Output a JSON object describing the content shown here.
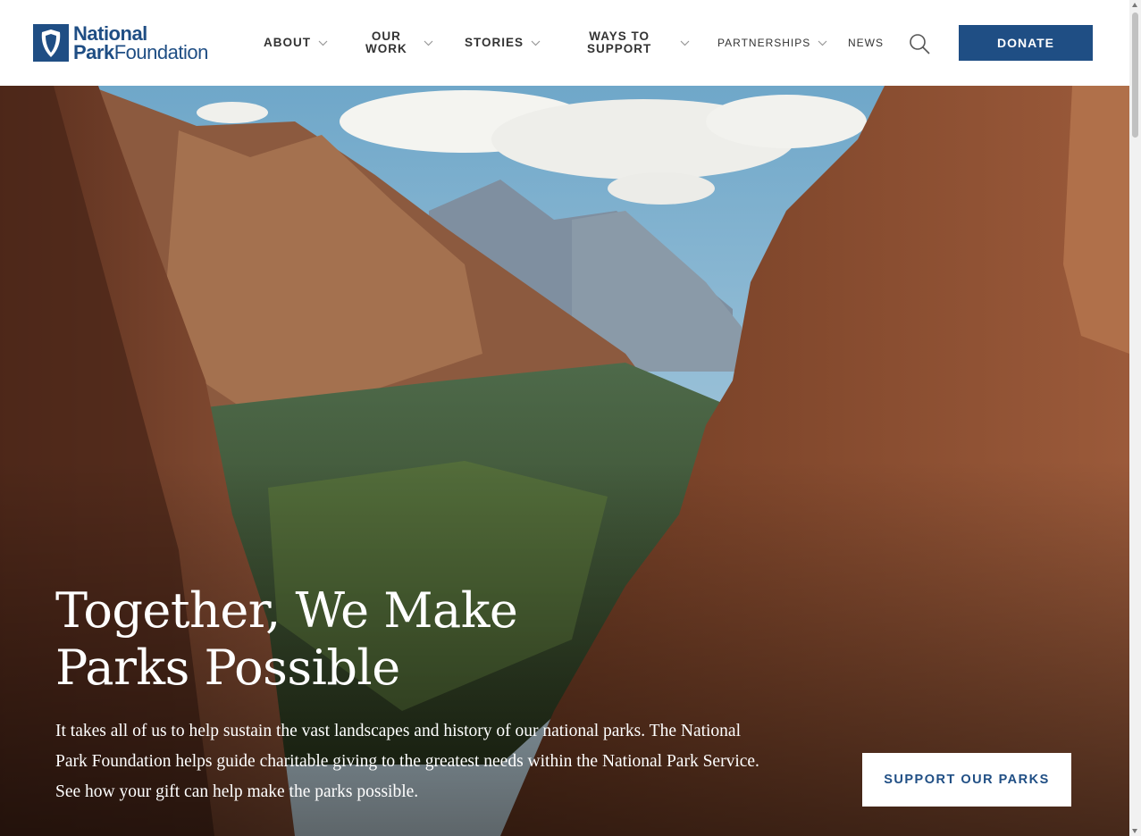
{
  "brand": {
    "line1": "National",
    "line2_bold": "Park",
    "line2_rest": "Foundation",
    "logo_icon": "arrowhead-shield-icon",
    "color": "#1f4e84"
  },
  "nav": {
    "about": "ABOUT",
    "our_work_1": "OUR",
    "our_work_2": "WORK",
    "stories": "STORIES",
    "ways_1": "WAYS TO",
    "ways_2": "SUPPORT",
    "partnerships": "PARTNERSHIPS",
    "news": "NEWS",
    "search_icon": "search-icon",
    "chevron_icon": "chevron-down-icon"
  },
  "donate_label": "DONATE",
  "hero": {
    "title_line1": "Together, We Make",
    "title_line2": "Parks Possible",
    "body": "It takes all of us to help sustain the vast landscapes and history of our national parks. The National Park Foundation helps guide charitable giving to the greatest needs within the National Park Service. See how your gift can help make the parks possible.",
    "cta": "SUPPORT OUR PARKS"
  },
  "colors": {
    "primary": "#1f4e84",
    "hero_text": "#ffffff"
  }
}
